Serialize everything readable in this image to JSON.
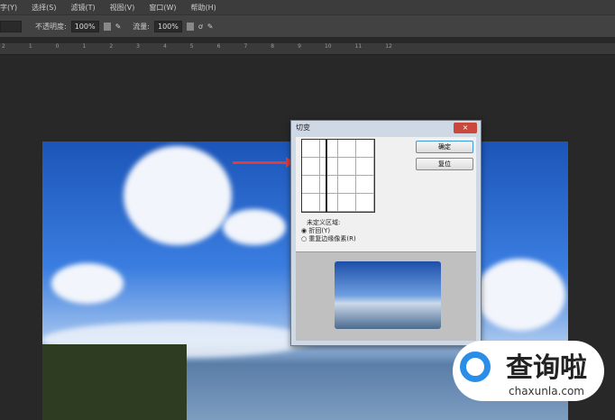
{
  "menu": [
    "字(Y)",
    "选择(S)",
    "滤镜(T)",
    "视图(V)",
    "窗口(W)",
    "帮助(H)"
  ],
  "options": {
    "opacity_label": "不透明度:",
    "opacity": "100%",
    "flow_label": "流量:",
    "flow": "100%"
  },
  "ruler": [
    "2",
    "1",
    "0",
    "1",
    "2",
    "3",
    "4",
    "5",
    "6",
    "7",
    "8",
    "9",
    "10",
    "11",
    "12"
  ],
  "dialog": {
    "title": "切变",
    "close": "×",
    "ok": "确定",
    "reset": "复位",
    "group_label": "未定义区域:",
    "options": [
      {
        "label": "折回(Y)",
        "selected": true
      },
      {
        "label": "重复边缘像素(R)",
        "selected": false
      }
    ]
  },
  "watermark": {
    "name": "查询啦",
    "url": "chaxunla.com"
  },
  "colors": {
    "accent": "#2a8ee8",
    "arrow": "#e23b3b"
  }
}
